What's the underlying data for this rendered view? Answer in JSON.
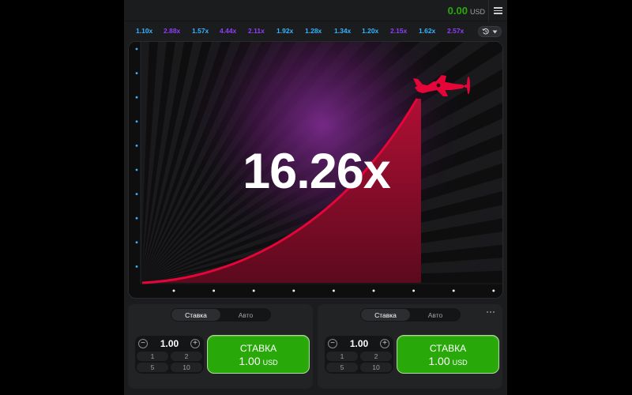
{
  "header": {
    "balance": "0.00",
    "currency": "USD"
  },
  "history": {
    "items": [
      {
        "value": "1.10x",
        "color": "#34b4ff"
      },
      {
        "value": "2.88x",
        "color": "#913ef8"
      },
      {
        "value": "1.57x",
        "color": "#34b4ff"
      },
      {
        "value": "4.44x",
        "color": "#913ef8"
      },
      {
        "value": "2.11x",
        "color": "#913ef8"
      },
      {
        "value": "1.92x",
        "color": "#34b4ff"
      },
      {
        "value": "1.28x",
        "color": "#34b4ff"
      },
      {
        "value": "1.34x",
        "color": "#34b4ff"
      },
      {
        "value": "1.20x",
        "color": "#34b4ff"
      },
      {
        "value": "2.15x",
        "color": "#913ef8"
      },
      {
        "value": "1.62x",
        "color": "#34b4ff"
      },
      {
        "value": "2.57x",
        "color": "#913ef8"
      }
    ]
  },
  "game": {
    "multiplier": "16.26x",
    "curve_color": "#e50539",
    "plane_color": "#e50539"
  },
  "bets": [
    {
      "tabs": [
        "Ставка",
        "Авто"
      ],
      "active_tab": 0,
      "stake": "1.00",
      "quick": [
        "1",
        "2",
        "5",
        "10"
      ],
      "button_title": "СТАВКА",
      "button_amount": "1.00",
      "button_currency": "USD"
    },
    {
      "tabs": [
        "Ставка",
        "Авто"
      ],
      "active_tab": 0,
      "stake": "1.00",
      "quick": [
        "1",
        "2",
        "5",
        "10"
      ],
      "button_title": "СТАВКА",
      "button_amount": "1.00",
      "button_currency": "USD"
    }
  ],
  "colors": {
    "accent_green": "#28a909",
    "history_blue": "#34b4ff",
    "history_purple": "#913ef8"
  }
}
